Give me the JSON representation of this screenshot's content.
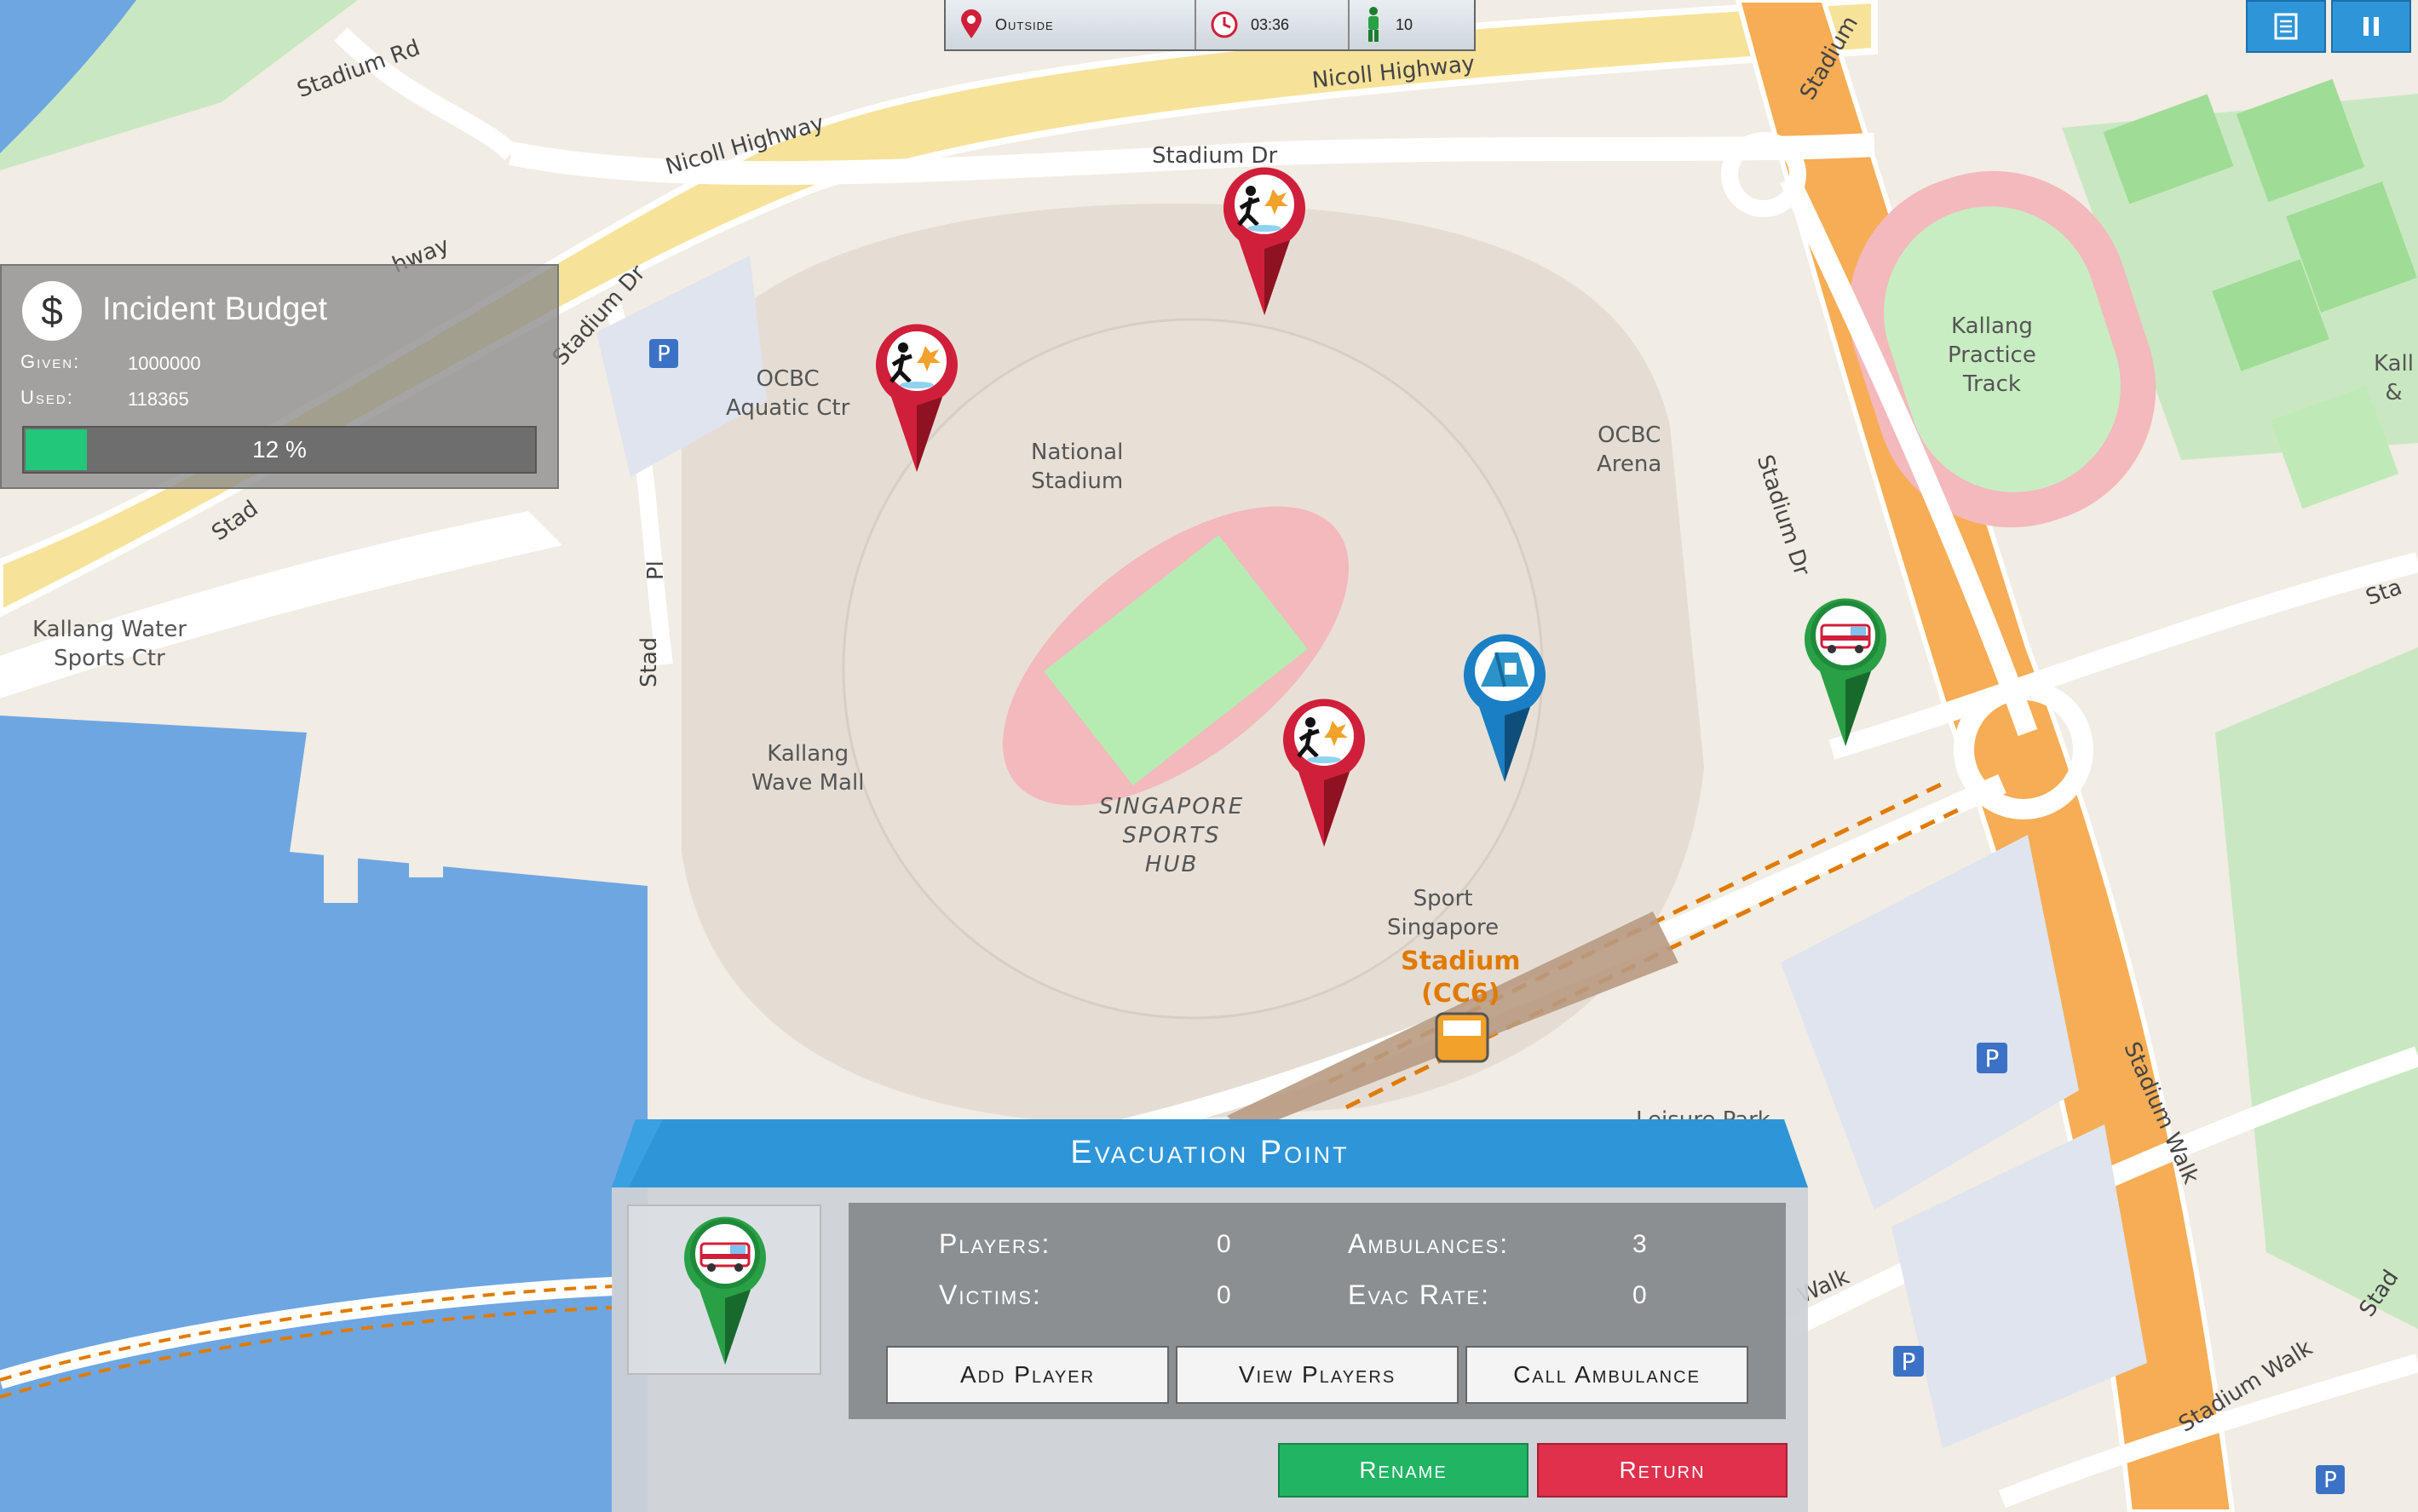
{
  "map": {
    "roads": {
      "stadium_rd": "Stadium Rd",
      "nicoll_highway_1": "Nicoll Highway",
      "nicoll_highway_2": "Nicoll Highway",
      "highway_fragment": "hway",
      "stadium_dr_top": "Stadium Dr",
      "stadium_dr_left": "Stadium Dr",
      "stadium_dr_right": "Stadium Dr",
      "stadium_walk_1": "Stadium Walk",
      "stadium_walk_2": "Stadium Walk",
      "stadium_top_right": "Stadium",
      "stad_left": "Stad",
      "stad_mid": "Stad",
      "pl": "Pl",
      "walk": "Walk",
      "sta_right": "Sta",
      "stad_far_right": "Stad"
    },
    "places": {
      "ocbc_aquatic": "OCBC\nAquatic Ctr",
      "national_stadium": "National\nStadium",
      "ocbc_arena": "OCBC\nArena",
      "kallang_practice": "Kallang\nPractice\nTrack",
      "kallang_water": "Kallang Water\nSports Ctr",
      "kallang_wave": "Kallang\nWave Mall",
      "sports_hub": "SINGAPORE\nSPORTS\nHUB",
      "sport_singapore": "Sport\nSingapore",
      "stadium_station": "Stadium\n(CC6)",
      "leisure_park": "Leisure Park",
      "kall_edge": "Kall\n&"
    }
  },
  "status": {
    "location": "Outside",
    "time": "03:36",
    "players": "10"
  },
  "topbuttons": {
    "log_icon": "log-icon",
    "pause_icon": "pause-icon"
  },
  "budget": {
    "title": "Incident Budget",
    "icon": "$",
    "given_label": "Given:",
    "given_value": "1000000",
    "used_label": "Used:",
    "used_value": "118365",
    "progress_fraction": 0.12,
    "progress_text": "12 %"
  },
  "evac": {
    "title": "Evacuation Point",
    "players_label": "Players:",
    "players_value": "0",
    "victims_label": "Victims:",
    "victims_value": "0",
    "ambulances_label": "Ambulances:",
    "ambulances_value": "3",
    "evac_rate_label": "Evac Rate:",
    "evac_rate_value": "0",
    "add_player": "Add Player",
    "view_players": "View Players",
    "call_ambulance": "Call Ambulance",
    "rename": "Rename",
    "return": "Return"
  },
  "colors": {
    "accent_blue": "#2e95d8",
    "incident_red": "#d01f3a",
    "evac_green": "#1f8a3a",
    "tent_blue": "#1a7fc4",
    "rename_green": "#20b463",
    "return_red": "#e0304c"
  }
}
